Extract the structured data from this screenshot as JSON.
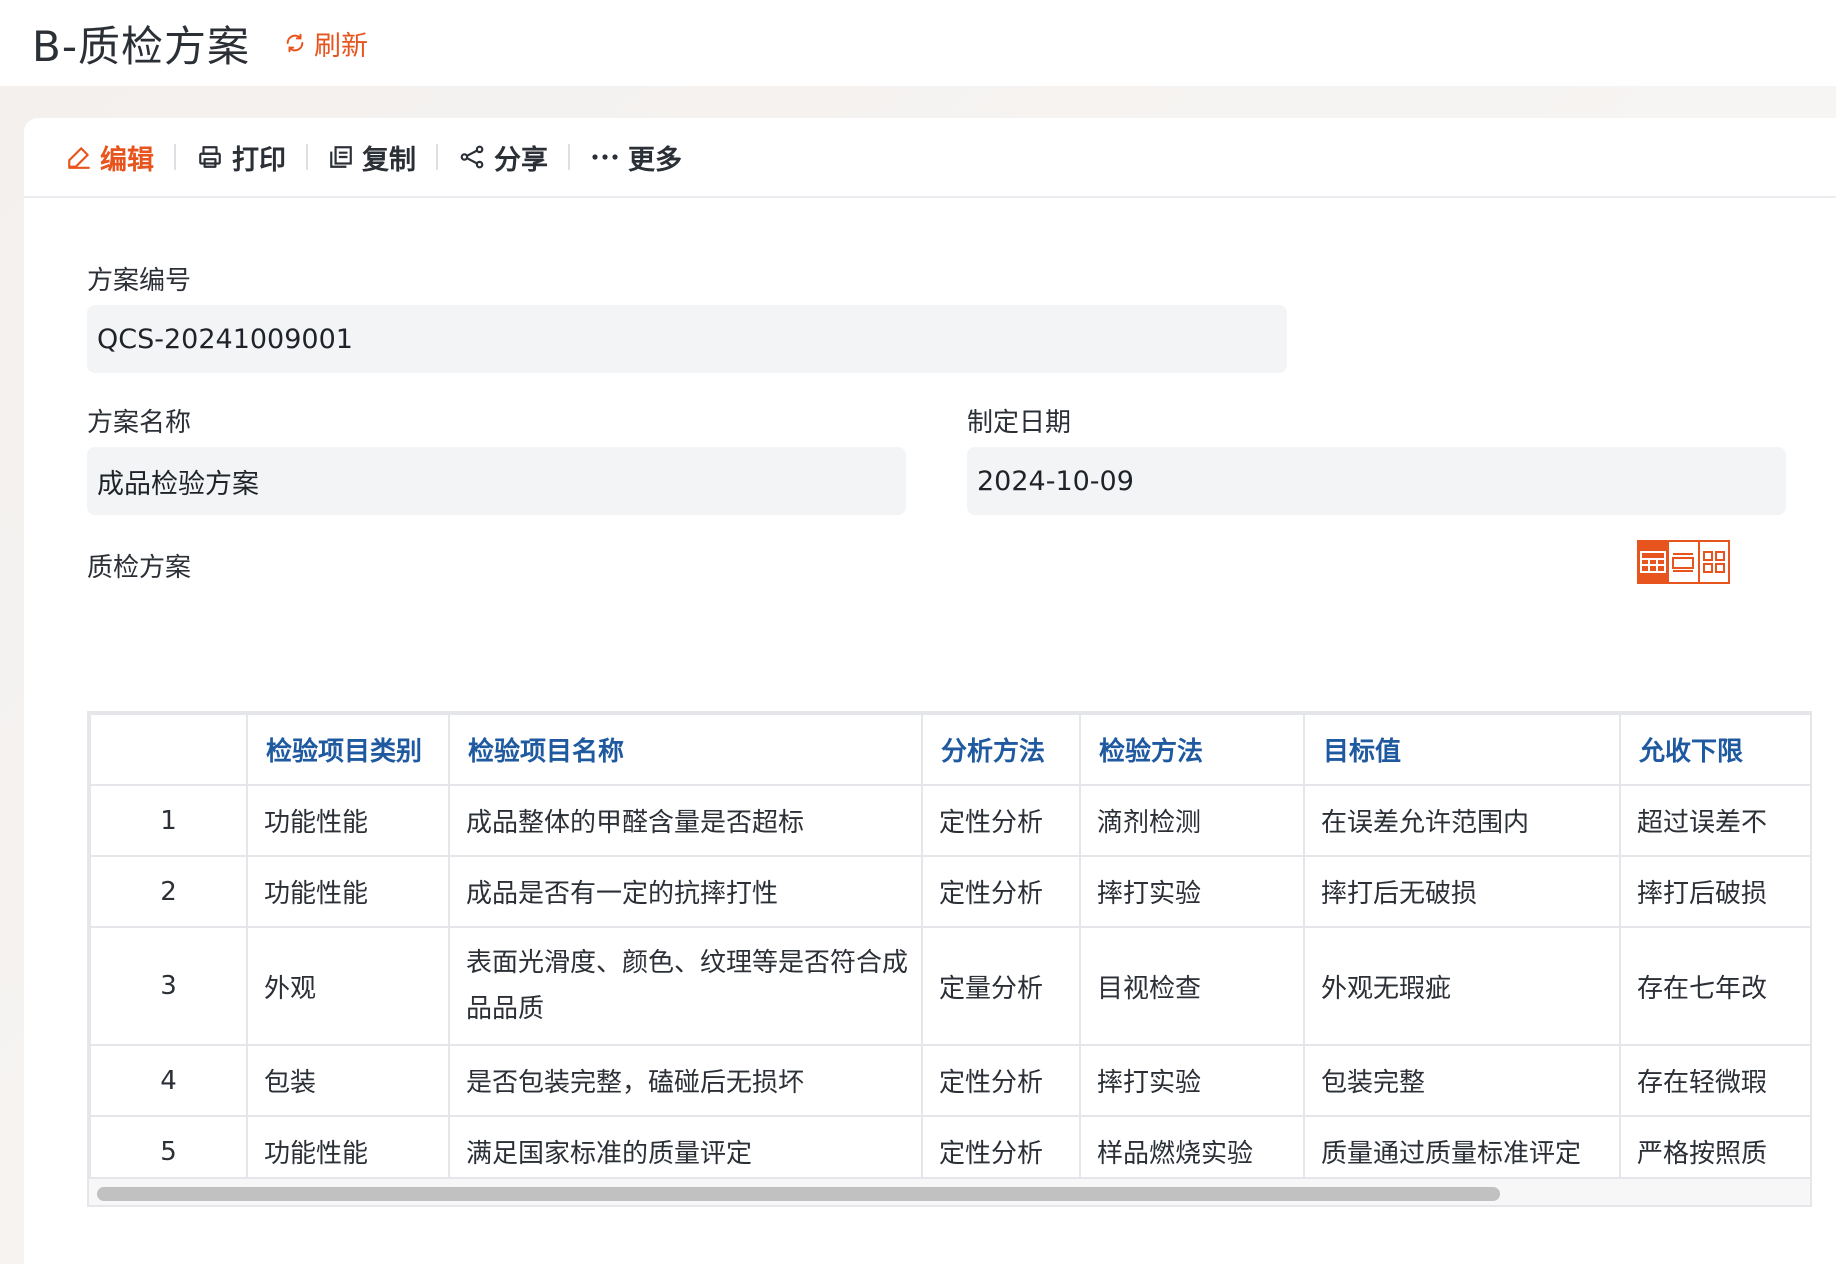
{
  "header": {
    "title": "B-质检方案",
    "refresh_label": "刷新"
  },
  "toolbar": {
    "edit": "编辑",
    "print": "打印",
    "copy": "复制",
    "share": "分享",
    "more": "更多"
  },
  "form": {
    "plan_no_label": "方案编号",
    "plan_no_value": "QCS-20241009001",
    "plan_name_label": "方案名称",
    "plan_name_value": "成品检验方案",
    "date_label": "制定日期",
    "date_value": "2024-10-09",
    "section_label": "质检方案"
  },
  "table": {
    "headers": [
      "",
      "检验项目类别",
      "检验项目名称",
      "分析方法",
      "检验方法",
      "目标值",
      "允收下限"
    ],
    "rows": [
      [
        "1",
        "功能性能",
        "成品整体的甲醛含量是否超标",
        "定性分析",
        "滴剂检测",
        "在误差允许范围内",
        "超过误差不"
      ],
      [
        "2",
        "功能性能",
        "成品是否有一定的抗摔打性",
        "定性分析",
        "摔打实验",
        "摔打后无破损",
        "摔打后破损"
      ],
      [
        "3",
        "外观",
        "表面光滑度、颜色、纹理等是否符合成品品质",
        "定量分析",
        "目视检查",
        "外观无瑕疵",
        "存在七年改"
      ],
      [
        "4",
        "包装",
        "是否包装完整，磕碰后无损坏",
        "定性分析",
        "摔打实验",
        "包装完整",
        "存在轻微瑕"
      ],
      [
        "5",
        "功能性能",
        "满足国家标准的质量评定",
        "定性分析",
        "样品燃烧实验",
        "质量通过质量标准评定",
        "严格按照质"
      ]
    ]
  },
  "colors": {
    "accent": "#e8541d",
    "header_text": "#1f5aa0"
  }
}
